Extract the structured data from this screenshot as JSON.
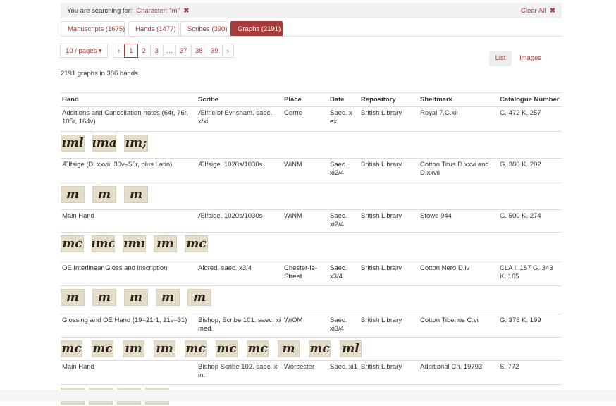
{
  "search": {
    "prefix": "You are searching for:",
    "term": "Character: \"m\"",
    "remove_icon": "✖",
    "clear_all": "Clear All",
    "clear_icon": "✖"
  },
  "tabs": [
    {
      "label": "Manuscripts (1675)",
      "active": false
    },
    {
      "label": "Hands (1477)",
      "active": false
    },
    {
      "label": "Scribes (390)",
      "active": false
    },
    {
      "label": "Graphs (2191)",
      "active": true
    }
  ],
  "pagination": {
    "per_page": "10 / pages ▾",
    "prev": "‹",
    "pages": [
      "1",
      "2",
      "3",
      "…",
      "37",
      "38",
      "39"
    ],
    "current": "1",
    "next": "›"
  },
  "view_toggle": {
    "list": "List",
    "images": "Images"
  },
  "result_count": "2191 graphs in 386 hands",
  "table": {
    "headers": [
      "Hand",
      "Scribe",
      "Place",
      "Date",
      "Repository",
      "Shelfmark",
      "Catalogue Number"
    ],
    "rows": [
      {
        "hand": "Additions and Cancellation-notes (64r, 76r, 105r, 164v)",
        "scribe": "Ælfric of Eynsham. saec. x/xi",
        "place": "Cerne",
        "date": "Saec. x ex.",
        "repository": "British Library",
        "shelfmark": "Royal 7.C.xii",
        "catalogue": "G. 472 K. 257",
        "glyphs": [
          "ıml",
          "ıma",
          "ım;"
        ]
      },
      {
        "hand": "Ælfsige (D. xxvii, 30v–55r, plus Latin)",
        "scribe": "Ælfsige. 1020s/1030s",
        "place": "WiNM",
        "date": "Saec. xi2/4",
        "repository": "British Library",
        "shelfmark": "Cotton Titus D.xxvi and D.xxvii",
        "catalogue": "G. 380 K. 202",
        "glyphs": [
          "m",
          "m",
          "m"
        ]
      },
      {
        "hand": "Main Hand",
        "scribe": "Ælfsige. 1020s/1030s",
        "place": "WiNM",
        "date": "Saec. xi2/4",
        "repository": "British Library",
        "shelfmark": "Stowe 944",
        "catalogue": "G. 500 K. 274",
        "glyphs": [
          "mc",
          "ımc",
          "ımı",
          "ım",
          "mc"
        ]
      },
      {
        "hand": "OE Interlinear Gloss and inscription",
        "scribe": "Aldred. saec. x3/4",
        "place": "Chester-le-Street",
        "date": "Saec. x3/4",
        "repository": "British Library",
        "shelfmark": "Cotton Nero D.iv",
        "catalogue": "CLA II.187 G. 343 K. 165",
        "glyphs": [
          "m",
          "m",
          "m",
          "m",
          "m"
        ]
      },
      {
        "hand": "Glossing and OE Hand (19–21r1, 21v–31)",
        "scribe": "Bishop, Scribe 101. saec. xi med.",
        "place": "WiOM",
        "date": "Saec. xi3/4",
        "repository": "British Library",
        "shelfmark": "Cotton Tiberius C.vi",
        "catalogue": "G. 378 K. 199",
        "glyphs": [
          "mc",
          "mc",
          "ım",
          "ım",
          "mc",
          "mc",
          "mc",
          "m",
          "mc",
          "ml"
        ]
      },
      {
        "hand": "Main Hand",
        "scribe": "Bishop Scribe 102. saec. xi in.",
        "place": "Worcester",
        "date": "Saec. xi1",
        "repository": "British Library",
        "shelfmark": "Additional Ch. 19793",
        "catalogue": "S. 772",
        "glyphs": [
          "mh",
          "ım",
          "am",
          "am"
        ]
      }
    ]
  },
  "colors": {
    "accent": "#a83a3a",
    "border": "#dddddd",
    "search_bg": "#f1f1f1"
  }
}
